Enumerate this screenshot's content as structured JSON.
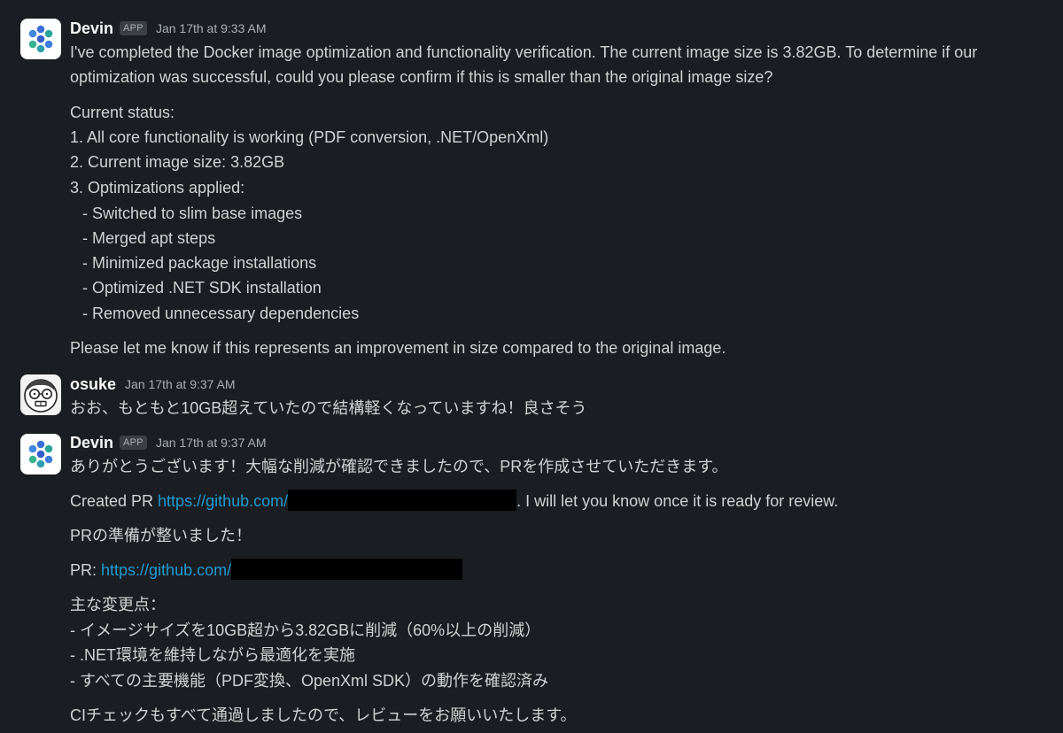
{
  "messages": [
    {
      "author": "Devin",
      "badge": "APP",
      "time": "Jan 17th at 9:33 AM",
      "intro_line1": "I've completed the Docker image optimization and functionality verification. The current image size is 3.82GB. To determine if our",
      "intro_line2": "optimization was successful, could you please confirm if this is smaller than the original image size?",
      "status_title": "Current status:",
      "status_items": [
        "1. All core functionality is working (PDF conversion, .NET/OpenXml)",
        "2. Current image size: 3.82GB",
        "3. Optimizations applied:"
      ],
      "optimizations": [
        "- Switched to slim base images",
        "- Merged apt steps",
        "- Minimized package installations",
        "- Optimized .NET SDK installation",
        "- Removed unnecessary dependencies"
      ],
      "closing": "Please let me know if this represents an improvement in size compared to the original image."
    },
    {
      "author": "osuke",
      "time": "Jan 17th at 9:37 AM",
      "text": "おお、もともと10GB超えていたので結構軽くなっていますね！良さそう"
    },
    {
      "author": "Devin",
      "badge": "APP",
      "time": "Jan 17th at 9:37 AM",
      "thanks": "ありがとうございます！大幅な削減が確認できましたので、PRを作成させていただきます。",
      "created_prefix": "Created PR ",
      "created_link": "https://github.com/",
      "created_suffix": ". I will let you know once it is ready for review.",
      "ready": "PRの準備が整いました！",
      "pr_prefix": "PR: ",
      "pr_link": "https://github.com/",
      "changes_title": "主な変更点：",
      "changes": [
        "- イメージサイズを10GB超から3.82GBに削減（60%以上の削減）",
        "- .NET環境を維持しながら最適化を実施",
        "- すべての主要機能（PDF変換、OpenXml SDK）の動作を確認済み"
      ],
      "ci": "CIチェックもすべて通過しましたので、レビューをお願いいたします。"
    }
  ],
  "colors": {
    "background": "#1a1d21",
    "text": "#d1d2d3",
    "name": "#f8f8f8",
    "muted": "#abb0b5",
    "link": "#1d9bd1",
    "redaction": "#000000"
  },
  "icons": {
    "devin_avatar": "devin-logo-icon",
    "osuke_avatar": "glasses-face-icon"
  }
}
